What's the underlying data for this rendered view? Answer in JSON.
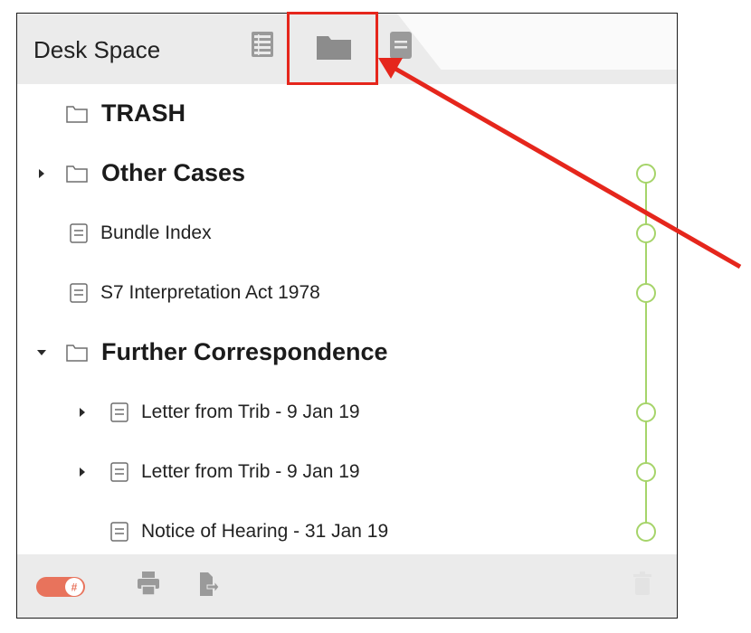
{
  "header": {
    "title": "Desk Space",
    "views": [
      {
        "icon": "outline-list-icon"
      },
      {
        "icon": "folder-icon",
        "highlighted": true
      },
      {
        "icon": "document-icon"
      }
    ]
  },
  "tree": {
    "items": [
      {
        "label": "TRASH",
        "type": "folder",
        "level": 0,
        "expander": "none",
        "timeline": false
      },
      {
        "label": "Other Cases",
        "type": "folder",
        "level": 0,
        "expander": "collapsed",
        "timeline": true
      },
      {
        "label": "Bundle Index",
        "type": "document",
        "level": 0,
        "expander": "none",
        "timeline": true
      },
      {
        "label": "S7 Interpretation Act 1978",
        "type": "document",
        "level": 0,
        "expander": "none",
        "timeline": true
      },
      {
        "label": "Further Correspondence",
        "type": "folder",
        "level": 0,
        "expander": "expanded",
        "timeline": false
      },
      {
        "label": "Letter from Trib - 9 Jan 19",
        "type": "document",
        "level": 1,
        "expander": "collapsed",
        "timeline": true
      },
      {
        "label": "Letter from Trib - 9 Jan 19",
        "type": "document",
        "level": 1,
        "expander": "collapsed",
        "timeline": true
      },
      {
        "label": "Notice of Hearing - 31 Jan 19",
        "type": "document",
        "level": 1,
        "expander": "none",
        "timeline": true
      }
    ]
  },
  "footer": {
    "toggle_badge": "#",
    "tools": [
      "toggle-switch",
      "printer-icon",
      "export-icon",
      "trash-icon"
    ]
  },
  "colors": {
    "timeline": "#a6d46a",
    "toggle": "#e8735c",
    "annotation": "#e5261c",
    "icon": "#9a9a9a"
  }
}
